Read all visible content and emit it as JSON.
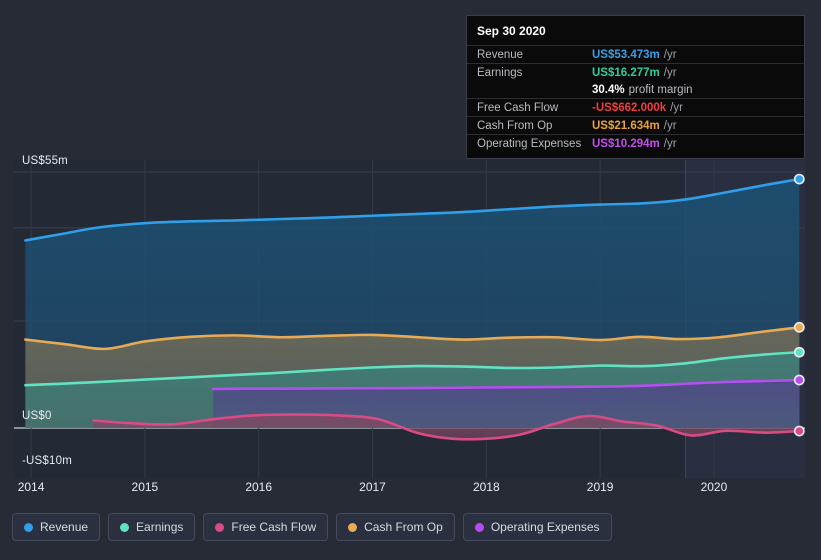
{
  "chart_data": {
    "type": "area",
    "title": "",
    "xlabel": "",
    "ylabel": "",
    "x_tick_labels": [
      "2014",
      "2015",
      "2016",
      "2017",
      "2018",
      "2019",
      "2020"
    ],
    "x_ticks": [
      2014,
      2015,
      2016,
      2017,
      2018,
      2019,
      2020
    ],
    "y_tick_labels": [
      "US$55m",
      "US$0",
      "-US$10m"
    ],
    "y_ticks": [
      55,
      0,
      -10
    ],
    "ylim": [
      -12.5,
      58.5
    ],
    "xlim": [
      2013.85,
      2020.8
    ],
    "grid": true,
    "legend_position": "bottom-left",
    "units": "US$ millions",
    "forecast_start": 2019.75,
    "series": [
      {
        "name": "Revenue",
        "color": "#2e9fe8",
        "fill": "#1d4f72",
        "x": [
          2013.95,
          2014.25,
          2014.6,
          2015.0,
          2015.4,
          2015.8,
          2016.2,
          2016.6,
          2017.0,
          2017.4,
          2017.8,
          2018.2,
          2018.6,
          2019.0,
          2019.4,
          2019.75,
          2020.1,
          2020.45,
          2020.75
        ],
        "values": [
          40.3,
          41.6,
          43.1,
          44.0,
          44.4,
          44.6,
          44.9,
          45.2,
          45.6,
          46.0,
          46.4,
          47.0,
          47.6,
          48.0,
          48.3,
          49.1,
          50.6,
          52.2,
          53.473
        ]
      },
      {
        "name": "Earnings",
        "color": "#5fe3c0",
        "fill": "#3e7d77",
        "x": [
          2013.95,
          2014.25,
          2014.6,
          2015.0,
          2015.4,
          2015.8,
          2016.2,
          2016.6,
          2017.0,
          2017.4,
          2017.8,
          2018.2,
          2018.6,
          2019.0,
          2019.4,
          2019.75,
          2020.1,
          2020.45,
          2020.75
        ],
        "values": [
          9.2,
          9.5,
          9.9,
          10.4,
          10.9,
          11.4,
          11.9,
          12.5,
          13.0,
          13.3,
          13.2,
          12.9,
          13.0,
          13.4,
          13.3,
          13.9,
          15.0,
          15.8,
          16.277
        ]
      },
      {
        "name": "Free Cash Flow",
        "color": "#d94b85",
        "fill": "#7d4a62",
        "x": [
          2014.55,
          2014.9,
          2015.25,
          2015.6,
          2015.95,
          2016.3,
          2016.7,
          2017.05,
          2017.4,
          2017.7,
          2018.0,
          2018.3,
          2018.6,
          2018.9,
          2019.2,
          2019.5,
          2019.8,
          2020.1,
          2020.45,
          2020.75
        ],
        "values": [
          1.6,
          1.0,
          0.8,
          1.9,
          2.7,
          2.9,
          2.7,
          1.9,
          -1.1,
          -2.3,
          -2.3,
          -1.4,
          0.9,
          2.6,
          1.4,
          0.5,
          -1.6,
          -0.6,
          -1.0,
          -0.662
        ]
      },
      {
        "name": "Cash From Op",
        "color": "#e8aa55",
        "fill": "#6d6a58",
        "x": [
          2013.95,
          2014.3,
          2014.65,
          2015.0,
          2015.4,
          2015.8,
          2016.2,
          2016.6,
          2017.0,
          2017.4,
          2017.8,
          2018.2,
          2018.6,
          2019.0,
          2019.35,
          2019.7,
          2020.05,
          2020.4,
          2020.75
        ],
        "values": [
          19.0,
          18.0,
          17.0,
          18.6,
          19.6,
          19.9,
          19.5,
          19.8,
          20.0,
          19.5,
          19.0,
          19.4,
          19.5,
          18.9,
          19.6,
          19.1,
          19.5,
          20.6,
          21.634
        ]
      },
      {
        "name": "Operating Expenses",
        "color": "#b44ef0",
        "fill": "#4f4a86",
        "x": [
          2015.6,
          2016.0,
          2016.5,
          2017.0,
          2017.5,
          2018.0,
          2018.5,
          2019.0,
          2019.4,
          2019.75,
          2020.1,
          2020.45,
          2020.75
        ],
        "values": [
          8.4,
          8.45,
          8.5,
          8.55,
          8.6,
          8.7,
          8.8,
          8.9,
          9.1,
          9.5,
          9.9,
          10.1,
          10.294
        ]
      }
    ]
  },
  "tooltip": {
    "title": "Sep 30 2020",
    "rows": [
      {
        "label": "Revenue",
        "value": "US$53.473m",
        "unit": "/yr",
        "color": "#3d9fe8",
        "sub": ""
      },
      {
        "label": "Earnings",
        "value": "US$16.277m",
        "unit": "/yr",
        "color": "#2fce9f",
        "sub": ""
      },
      {
        "label": "",
        "value": "30.4%",
        "unit": "",
        "color": "#ffffff",
        "sub": "profit margin"
      },
      {
        "label": "Free Cash Flow",
        "value": "-US$662.000k",
        "unit": "/yr",
        "color": "#ef3f3f",
        "sub": ""
      },
      {
        "label": "Cash From Op",
        "value": "US$21.634m",
        "unit": "/yr",
        "color": "#e8a33c",
        "sub": ""
      },
      {
        "label": "Operating Expenses",
        "value": "US$10.294m",
        "unit": "/yr",
        "color": "#c24ef0",
        "sub": ""
      }
    ]
  },
  "legend": {
    "items": [
      {
        "label": "Revenue",
        "color": "#2e9fe8"
      },
      {
        "label": "Earnings",
        "color": "#5fe3c0"
      },
      {
        "label": "Free Cash Flow",
        "color": "#d94b85"
      },
      {
        "label": "Cash From Op",
        "color": "#e8aa55"
      },
      {
        "label": "Operating Expenses",
        "color": "#b44ef0"
      }
    ]
  }
}
